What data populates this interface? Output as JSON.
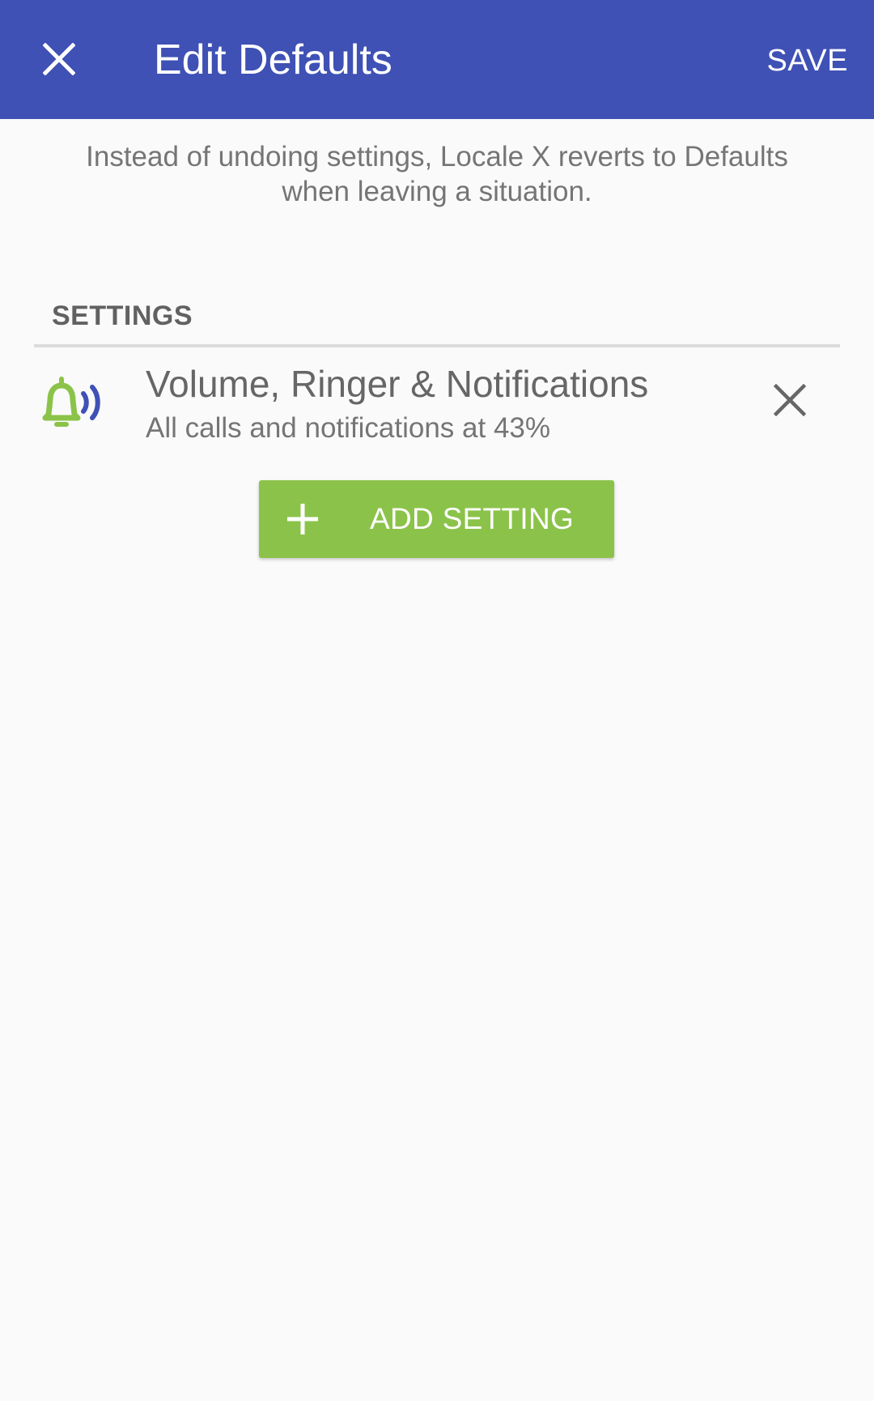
{
  "colors": {
    "app_bar": "#3f51b5",
    "accent_green": "#8bc34a",
    "background": "#fafafa"
  },
  "app_bar": {
    "close_icon": "close-icon",
    "title": "Edit Defaults",
    "save_label": "SAVE"
  },
  "intro_text": "Instead of undoing settings, Locale X reverts to Defaults when leaving a situation.",
  "settings_section": {
    "header": "SETTINGS",
    "items": [
      {
        "icon": "bell-ringing-icon",
        "title": "Volume, Ringer & Notifications",
        "subtitle": "All calls and notifications at 43%",
        "remove_icon": "close-icon"
      }
    ]
  },
  "add_setting": {
    "icon": "plus-icon",
    "label": "ADD SETTING"
  }
}
